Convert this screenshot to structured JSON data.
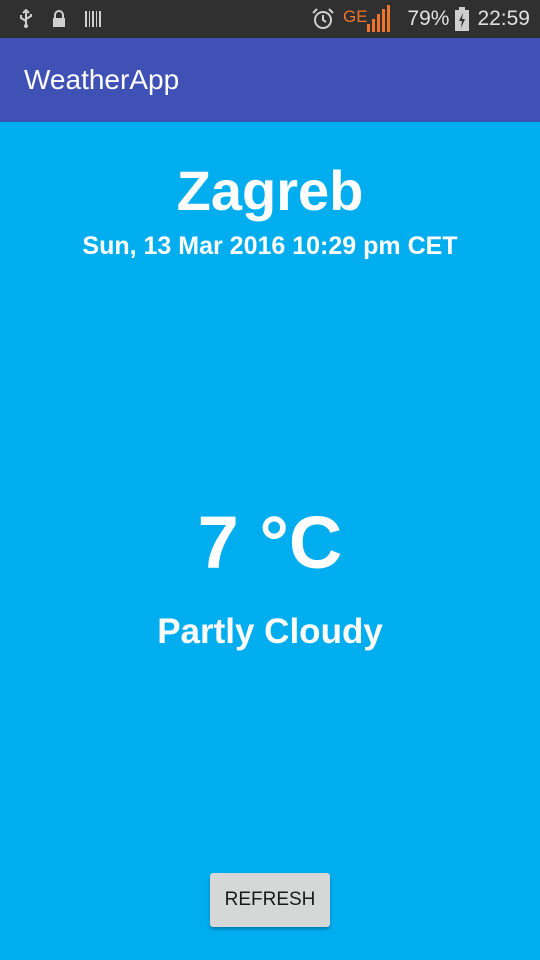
{
  "status_bar": {
    "icons_left": [
      "usb-icon",
      "lock-icon",
      "barcode-icon"
    ],
    "icons_right": [
      "alarm-icon",
      "signal-icon",
      "battery-icon"
    ],
    "network_type": "GE",
    "battery": "79%",
    "time": "22:59"
  },
  "app_bar": {
    "title": "WeatherApp"
  },
  "weather": {
    "city": "Zagreb",
    "datetime": "Sun, 13 Mar 2016 10:29 pm CET",
    "temperature": "7 °C",
    "condition": "Partly Cloudy"
  },
  "actions": {
    "refresh_label": "REFRESH"
  },
  "colors": {
    "background": "#00AEEF",
    "app_bar": "#3F51B5",
    "status_bar": "#303030",
    "signal": "#F0742A",
    "button": "#D6D7D7"
  }
}
